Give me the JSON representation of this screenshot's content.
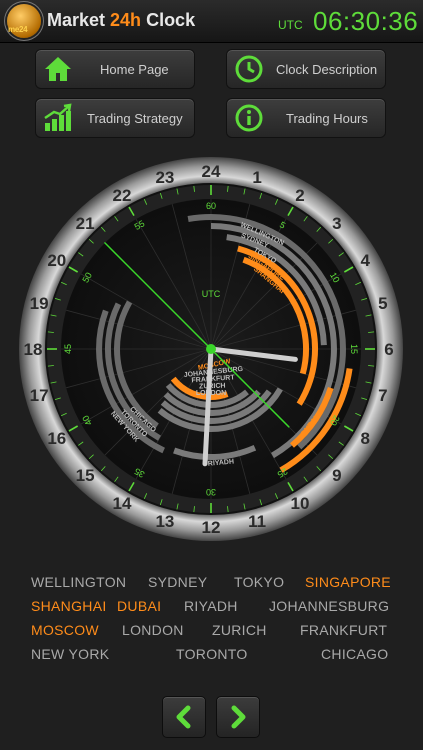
{
  "header": {
    "logo_text": "me24",
    "title_a": "Market ",
    "title_b": "24h",
    "title_c": " Clock",
    "utc_label": "UTC",
    "utc_time": "06:30:36"
  },
  "buttons": [
    {
      "label": "Home Page",
      "icon": "home-icon"
    },
    {
      "label": "Clock Description",
      "icon": "clock-icon"
    },
    {
      "label": "Trading Strategy",
      "icon": "chart-icon"
    },
    {
      "label": "Trading Hours",
      "icon": "info-icon"
    }
  ],
  "clock": {
    "center_label": "UTC",
    "hour_numbers": [
      "24",
      "1",
      "2",
      "3",
      "4",
      "5",
      "6",
      "7",
      "8",
      "9",
      "10",
      "11",
      "12",
      "13",
      "14",
      "15",
      "16",
      "17",
      "18",
      "19",
      "20",
      "21",
      "22",
      "23"
    ],
    "minute_numbers": [
      "60",
      "5",
      "10",
      "15",
      "20",
      "25",
      "30",
      "35",
      "40",
      "45",
      "50",
      "55"
    ],
    "arc_labels": [
      "WELLINGTON",
      "SYDNEY",
      "TOKYO",
      "SINGAPORE",
      "SHANGHAI",
      "LONDON",
      "ZURICH",
      "FRANKFURT",
      "JOHANNESBURG",
      "MOSCOW",
      "NEW YORK",
      "TORONTO",
      "CHICAGO",
      "DUBAI",
      "RIYADH"
    ]
  },
  "cities": [
    {
      "name": "WELLINGTON",
      "active": false
    },
    {
      "name": "SYDNEY",
      "active": false
    },
    {
      "name": "TOKYO",
      "active": false
    },
    {
      "name": "SINGAPORE",
      "active": true
    },
    {
      "name": "SHANGHAI",
      "active": true
    },
    {
      "name": "DUBAI",
      "active": true
    },
    {
      "name": "RIYADH",
      "active": false
    },
    {
      "name": "JOHANNESBURG",
      "active": false
    },
    {
      "name": "MOSCOW",
      "active": true
    },
    {
      "name": "LONDON",
      "active": false
    },
    {
      "name": "ZURICH",
      "active": false
    },
    {
      "name": "FRANKFURT",
      "active": false
    },
    {
      "name": "NEW YORK",
      "active": false
    },
    {
      "name": "TORONTO",
      "active": false
    },
    {
      "name": "CHICAGO",
      "active": false
    }
  ],
  "colors": {
    "accent": "#ff8c1a",
    "green": "#5edc3a",
    "inactive_text": "#a9a9a9"
  },
  "nav": {
    "prev_icon": "chevron-left-icon",
    "next_icon": "chevron-right-icon"
  }
}
